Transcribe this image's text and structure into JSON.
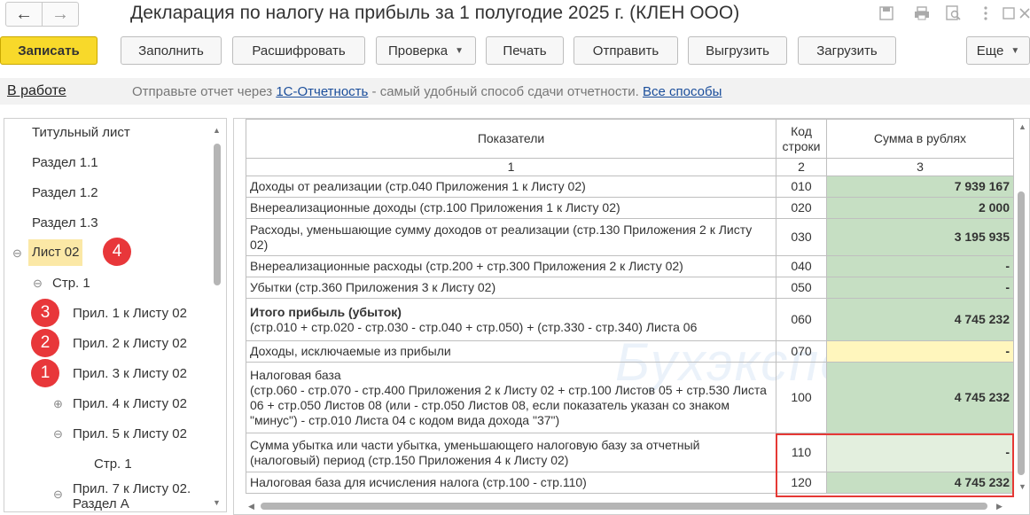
{
  "window": {
    "title": "Декларация по налогу на прибыль за 1 полугодие 2025 г. (КЛЕН ООО)",
    "back_icon": "←",
    "forward_icon": "→",
    "icons": [
      "save-icon",
      "print-icon",
      "preview-icon",
      "more-icon",
      "maximize-icon",
      "close-icon"
    ]
  },
  "toolbar": {
    "save_label": "Записать",
    "fill_label": "Заполнить",
    "decode_label": "Расшифровать",
    "check_label": "Проверка",
    "print_label": "Печать",
    "send_label": "Отправить",
    "export_label": "Выгрузить",
    "import_label": "Загрузить",
    "more_label": "Еще"
  },
  "infobar": {
    "status": "В работе",
    "text_before": "Отправьте отчет через ",
    "link1": "1С-Отчетность",
    "text_middle": " - самый удобный способ сдачи отчетности. ",
    "link2": "Все способы"
  },
  "watermark": "Бухэксперт",
  "tree": {
    "items": [
      "Титульный лист",
      "Раздел 1.1",
      "Раздел 1.2",
      "Раздел 1.3",
      "Лист 02",
      "Стр. 1",
      "Прил. 1 к Листу 02",
      "Прил. 2 к Листу 02",
      "Прил. 3 к Листу 02",
      "Прил. 4 к Листу 02",
      "Прил. 5 к Листу 02",
      "Стр. 1",
      "Прил. 7 к Листу 02. Раздел А"
    ],
    "selected": "Лист 02",
    "badges": [
      "4",
      "3",
      "2",
      "1"
    ]
  },
  "table": {
    "headers": [
      "Показатели",
      "Код строки",
      "Сумма в рублях"
    ],
    "numbers": [
      "1",
      "2",
      "3"
    ],
    "rows": [
      {
        "label": "Доходы от реализации (стр.040 Приложения 1 к Листу 02)",
        "code": "010",
        "value": "7 939 167"
      },
      {
        "label": "Внереализационные доходы (стр.100 Приложения 1 к Листу 02)",
        "code": "020",
        "value": "2 000"
      },
      {
        "label": "Расходы, уменьшающие сумму доходов от реализации (стр.130 Приложения 2 к Листу 02)",
        "code": "030",
        "value": "3 195 935"
      },
      {
        "label": "Внереализационные расходы (стр.200 + стр.300 Приложения 2 к Листу 02)",
        "code": "040",
        "value": "-"
      },
      {
        "label": "Убытки (стр.360 Приложения 3 к Листу 02)",
        "code": "050",
        "value": "-"
      },
      {
        "label_bold": "Итого прибыль (убыток)",
        "label": "(стр.010 + стр.020 - стр.030 - стр.040 + стр.050) + (стр.330 - стр.340) Листа 06",
        "code": "060",
        "value": "4 745 232"
      },
      {
        "label": "Доходы, исключаемые из прибыли",
        "code": "070",
        "value": "-"
      },
      {
        "label_head": "Налоговая база",
        "label": "(стр.060 - стр.070 - стр.400 Приложения 2 к Листу 02 + стр.100 Листов 05 + стр.530 Листа 06 + стр.050 Листов 08 (или - стр.050 Листов 08, если показатель указан со знаком \"минус\") - стр.010 Листа 04 с кодом вида дохода \"37\")",
        "code": "100",
        "value": "4 745 232"
      },
      {
        "label": "Сумма убытка или части убытка, уменьшающего налоговую базу за отчетный (налоговый) период (стр.150 Приложения 4 к Листу 02)",
        "code": "110",
        "value": "-"
      },
      {
        "label": "Налоговая база для исчисления налога (стр.100 - стр.110)",
        "code": "120",
        "value": "4 745 232"
      }
    ]
  }
}
